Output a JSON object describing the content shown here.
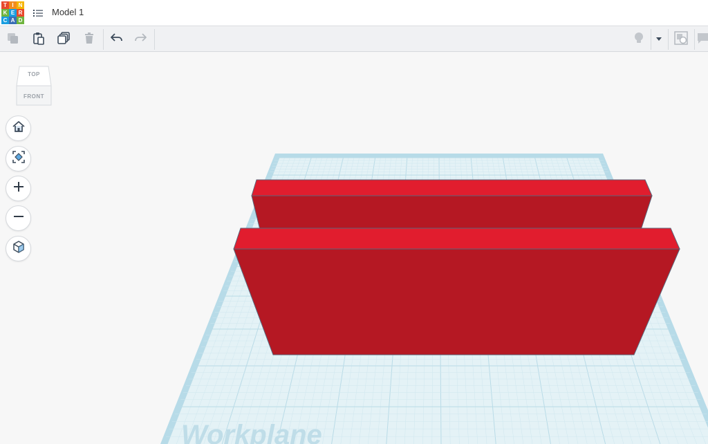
{
  "app": {
    "logo_letters": [
      "T",
      "I",
      "N",
      "K",
      "E",
      "R",
      "C",
      "A",
      "D"
    ],
    "logo_colors": [
      "#e8492c",
      "#f28c1e",
      "#f5b400",
      "#6fb43f",
      "#1a9ee0",
      "#e8492c",
      "#1a9ee0",
      "#3a6fb5",
      "#6fb43f"
    ],
    "title": "Model 1"
  },
  "toolbar": {
    "items": [
      {
        "name": "copy",
        "icon": "copy-icon",
        "enabled": false
      },
      {
        "name": "paste",
        "icon": "paste-icon",
        "enabled": true
      },
      {
        "name": "duplicate",
        "icon": "duplicate-icon",
        "enabled": true
      },
      {
        "name": "delete",
        "icon": "trash-icon",
        "enabled": false
      },
      {
        "name": "undo",
        "icon": "undo-icon",
        "enabled": true
      },
      {
        "name": "redo",
        "icon": "redo-icon",
        "enabled": false
      }
    ],
    "right_items": [
      {
        "name": "notes",
        "icon": "lightbulb-icon"
      },
      {
        "name": "notes-dropdown",
        "icon": "caret-down-icon"
      },
      {
        "name": "show-all",
        "icon": "show-all-icon"
      },
      {
        "name": "comment",
        "icon": "comment-icon"
      }
    ]
  },
  "viewcube": {
    "top_label": "TOP",
    "front_label": "FRONT"
  },
  "nav_controls": [
    {
      "name": "home-view",
      "icon": "home-icon"
    },
    {
      "name": "fit-view",
      "icon": "fit-view-icon"
    },
    {
      "name": "zoom-in",
      "icon": "plus-icon"
    },
    {
      "name": "zoom-out",
      "icon": "minus-icon"
    },
    {
      "name": "perspective",
      "icon": "cube-icon"
    }
  ],
  "workplane": {
    "label": "Workplane",
    "grid_color": "#cfe7ef",
    "border_color": "#a9d3e2"
  },
  "shapes": {
    "color_top": "#e11d2e",
    "color_front": "#b51823",
    "edge_color": "#5a6478",
    "count": 2
  },
  "colors": {
    "toolbar_bg": "#f0f1f3",
    "icon_active": "#3c4a5a",
    "icon_disabled": "#b4b9bf"
  }
}
